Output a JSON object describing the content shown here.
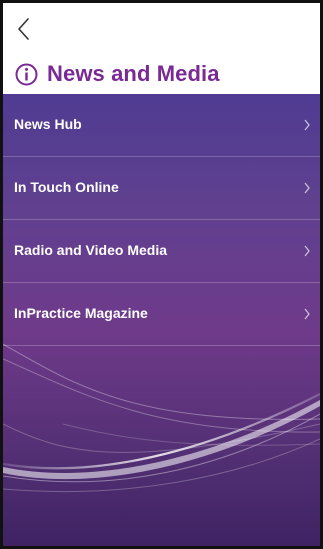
{
  "header": {
    "title": "News and Media",
    "back_icon": "chevron-left-icon",
    "info_icon": "info-circle-icon",
    "accent_color": "#7a2a94"
  },
  "menu": {
    "items": [
      {
        "label": "News Hub"
      },
      {
        "label": "In Touch Online"
      },
      {
        "label": "Radio and Video Media"
      },
      {
        "label": "InPractice Magazine"
      }
    ],
    "chevron_icon": "chevron-right-icon"
  }
}
